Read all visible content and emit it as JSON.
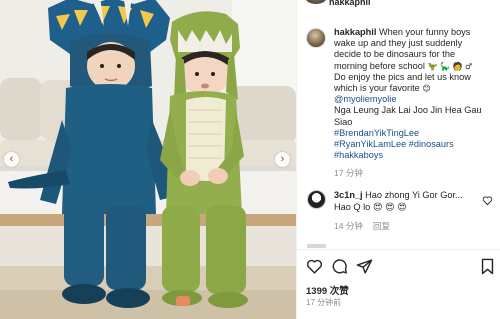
{
  "post": {
    "author": "hakkaphil",
    "caption_lines": [
      "When your funny boys",
      "wake up and they just suddenly",
      "decide to be dinosaurs for the",
      "morning before school",
      "Do enjoy the pics and let us know",
      "which is your favorite"
    ],
    "caption_emojis": "🦖 🦕 🧑 ♂",
    "favorite_emoji": "😊",
    "mention": "@myoliemyolie",
    "caption_text_2": "Nga Leung Jak Lai Joo Jin Hea Gau",
    "caption_text_3": "Siao",
    "hashtags": [
      "#BrendanYikTingLee",
      "#RyanYikLamLee #dinosaurs",
      "#hakkaboys"
    ],
    "time": "17 分钟"
  },
  "top_author": "hakkaphil",
  "comment": {
    "user": "3c1n_j",
    "text": "Hao zhong Yi Gor Gor...",
    "text_2": "Hao Q lo",
    "emojis": "😍 😍 😍",
    "time": "14 分钟",
    "reply_label": "回复"
  },
  "stats": {
    "likes": "1399 次赞",
    "posted": "17 分钟前"
  },
  "icons": [
    "heart-icon",
    "comment-icon",
    "share-icon",
    "bookmark-icon"
  ]
}
